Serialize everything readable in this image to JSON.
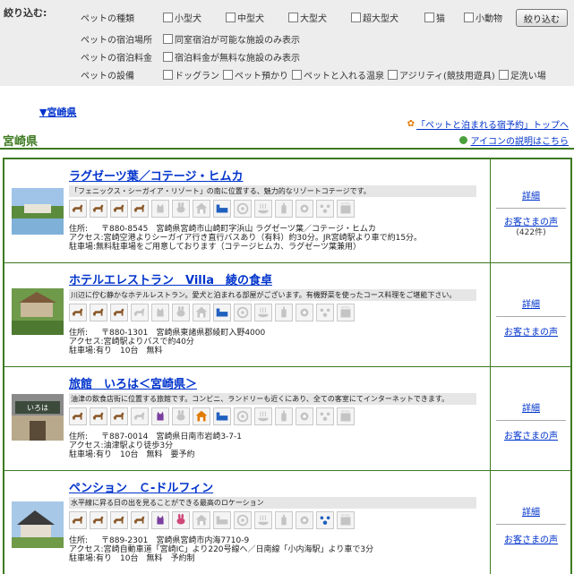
{
  "filter": {
    "title": "絞り込む:",
    "submit_label": "絞り込む",
    "rows": [
      {
        "label": "ペットの種類",
        "options": [
          "小型犬",
          "中型犬",
          "大型犬",
          "超大型犬",
          "猫",
          "小動物"
        ]
      },
      {
        "label": "ペットの宿泊場所",
        "options": [
          "同室宿泊が可能な施設のみ表示"
        ]
      },
      {
        "label": "ペットの宿泊料金",
        "options": [
          "宿泊料金が無料な施設のみ表示"
        ]
      },
      {
        "label": "ペットの設備",
        "options": [
          "ドッグラン",
          "ペット預かり",
          "ペットと入れる温泉",
          "アジリティ(競技用遊具)",
          "足洗い場"
        ]
      }
    ]
  },
  "anchor_link": "▼宮崎県",
  "top_link": "「ペットと泊まれる宿予約」トップへ",
  "icon_help_link": "アイコンの説明はこちら",
  "prefecture": "宮崎県",
  "listings": [
    {
      "name": "ラグゼーツ葉／コテージ・ヒムカ",
      "catch": "「フェニックス・シーガイア・リゾート」の南に位置する、魅力的なリゾートコテージです。",
      "address": "〒880-8545　宮崎県宮崎市山崎町字浜山 ラグゼーツ葉／コテージ・ヒムカ",
      "access": "宮崎空港よりシーガイア行き直行バスあり（有料）約30分。JR宮崎駅より車で約15分。",
      "parking": "無料駐車場をご用意しております（コテージヒムカ、ラグゼーツ葉兼用）",
      "details": "詳細",
      "voice": "お客さまの声",
      "voice_count": "(422件)"
    },
    {
      "name": "ホテルエレストラン　Villa　綾の食卓",
      "catch": "川辺に佇む静かなホテルレストラン。愛犬と泊まれる部屋がございます。有機野菜を使ったコース料理をご堪能下さい。",
      "address": "〒880-1301　宮崎県東諸県郡綾町入野4000",
      "access": "宮崎駅よりバスで約40分",
      "parking": "有り　10台　無料",
      "details": "詳細",
      "voice": "お客さまの声",
      "voice_count": ""
    },
    {
      "name": "旅館　いろは＜宮崎県＞",
      "catch": "油津の飲食店街に位置する旅館です。コンビニ、ランドリーも近くにあり、全ての客室にてインターネットできます。",
      "address": "〒887-0014　宮崎県日南市岩崎3-7-1",
      "access": "油津駅より徒歩3分",
      "parking": "有り　10台　無料　要予約",
      "details": "詳細",
      "voice": "お客さまの声",
      "voice_count": ""
    },
    {
      "name": "ペンション　Ｃ-ドルフィン",
      "catch": "水平線に昇る日の出を見ることができる最高のロケーション",
      "address": "〒889-2301　宮崎県宮崎市内海7710-9",
      "access": "宮崎自動車道「宮崎IC」より220号線へ／日南線「小内海駅」より車で3分",
      "parking": "有り　10台　無料　予約制",
      "details": "詳細",
      "voice": "お客さまの声",
      "voice_count": ""
    }
  ],
  "labels": {
    "address": "住所:",
    "access": "アクセス:",
    "parking": "駐車場:"
  },
  "colors": {
    "accent_green": "#3d7a21",
    "link_blue": "#0033cc",
    "icon_active_brown": "#8b5a2b",
    "icon_active_blue": "#1f5fbf",
    "icon_active_purple": "#7a3fa0",
    "icon_active_orange": "#e07800",
    "icon_active_pink": "#d04878",
    "icon_inactive": "#c4c4c4"
  },
  "icon_sets": [
    [
      "small-dog",
      "medium-dog",
      "large-dog",
      "xl-dog",
      "cat",
      "small-animal",
      "kennel",
      "room",
      "dog-run",
      "onsen",
      "shampoo",
      "amenity",
      "agility",
      "hotel"
    ],
    [
      "small-dog",
      "medium-dog",
      "large-dog",
      "xl-dog",
      "cat",
      "small-animal",
      "kennel",
      "room",
      "dog-run",
      "onsen",
      "shampoo",
      "amenity",
      "agility",
      "hotel"
    ],
    [
      "small-dog",
      "medium-dog",
      "large-dog",
      "xl-dog",
      "cat",
      "small-animal",
      "kennel",
      "room",
      "dog-run",
      "onsen",
      "shampoo",
      "amenity",
      "agility",
      "hotel"
    ],
    [
      "small-dog",
      "medium-dog",
      "large-dog",
      "xl-dog",
      "cat",
      "small-animal",
      "kennel",
      "room",
      "dog-run",
      "onsen",
      "shampoo",
      "amenity",
      "agility",
      "hotel"
    ]
  ],
  "icon_states": [
    [
      1,
      1,
      1,
      1,
      0,
      0,
      0,
      1,
      0,
      0,
      0,
      0,
      0,
      0
    ],
    [
      1,
      1,
      1,
      0,
      0,
      0,
      0,
      1,
      0,
      0,
      0,
      0,
      0,
      0
    ],
    [
      1,
      1,
      1,
      0,
      1,
      0,
      1,
      1,
      0,
      0,
      0,
      0,
      0,
      0
    ],
    [
      1,
      1,
      1,
      1,
      1,
      1,
      0,
      0,
      0,
      0,
      0,
      0,
      1,
      0
    ]
  ]
}
